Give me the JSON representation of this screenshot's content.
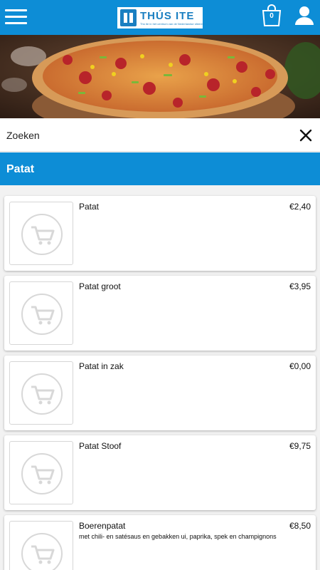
{
  "header": {
    "logo_name": "THÚS ITE",
    "logo_tagline": "Thú ite in het centrum van de Nederlandse sfeeren",
    "cart_count": "0"
  },
  "search": {
    "placeholder": "Zoeken"
  },
  "category": {
    "label": "Patat"
  },
  "products": [
    {
      "name": "Patat",
      "price": "€2,40",
      "description": ""
    },
    {
      "name": "Patat groot",
      "price": "€3,95",
      "description": ""
    },
    {
      "name": "Patat in zak",
      "price": "€0,00",
      "description": ""
    },
    {
      "name": "Patat Stoof",
      "price": "€9,75",
      "description": ""
    },
    {
      "name": "Boerenpatat",
      "price": "€8,50",
      "description": "met chili- en satésaus en gebakken ui, paprika, spek en champignons"
    }
  ],
  "colors": {
    "brand_blue": "#0d8dd6",
    "background": "#f2f2f2"
  },
  "icons": {
    "menu": "hamburger-icon",
    "cart": "shopping-bag-icon",
    "account": "user-icon",
    "clear": "close-icon",
    "product_placeholder": "shopping-cart-icon"
  }
}
